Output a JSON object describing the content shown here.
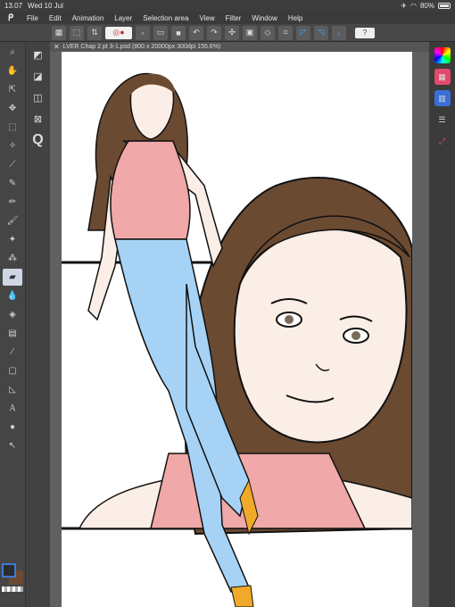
{
  "status": {
    "time": "13.07",
    "date": "Wed 10 Jul",
    "battery": "80%"
  },
  "menu": [
    "File",
    "Edit",
    "Animation",
    "Layer",
    "Selection area",
    "View",
    "Filter",
    "Window",
    "Help"
  ],
  "tab": {
    "title": "LVER Chap 2 pt 3-1.psd (800 x 20000px 300dpi 155.6%)"
  },
  "colors": {
    "skin": "#fbeee6",
    "hair": "#6b4a32",
    "top": "#f0a8a8",
    "jeans": "#a6d3f5",
    "shoe": "#f0a928",
    "line": "#111111"
  }
}
